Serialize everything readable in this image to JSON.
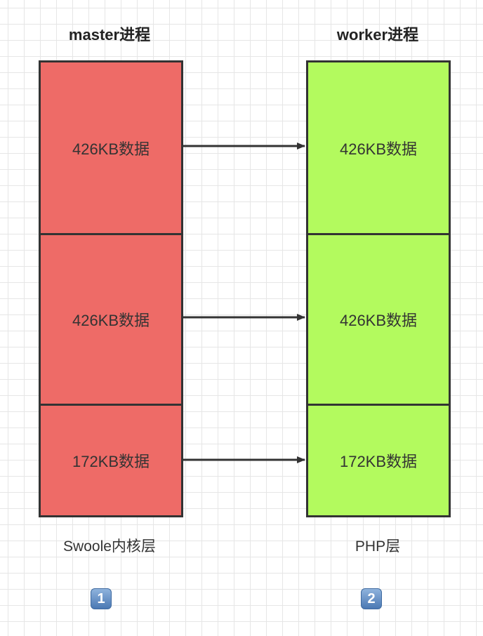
{
  "master": {
    "title": "master进程",
    "blocks": [
      "426KB数据",
      "426KB数据",
      "172KB数据"
    ],
    "footer": "Swoole内核层",
    "badge": "1",
    "color": "#ee6b67"
  },
  "worker": {
    "title": "worker进程",
    "blocks": [
      "426KB数据",
      "426KB数据",
      "172KB数据"
    ],
    "footer": "PHP层",
    "badge": "2",
    "color": "#b3fa5e"
  },
  "arrow_color": "#333333"
}
